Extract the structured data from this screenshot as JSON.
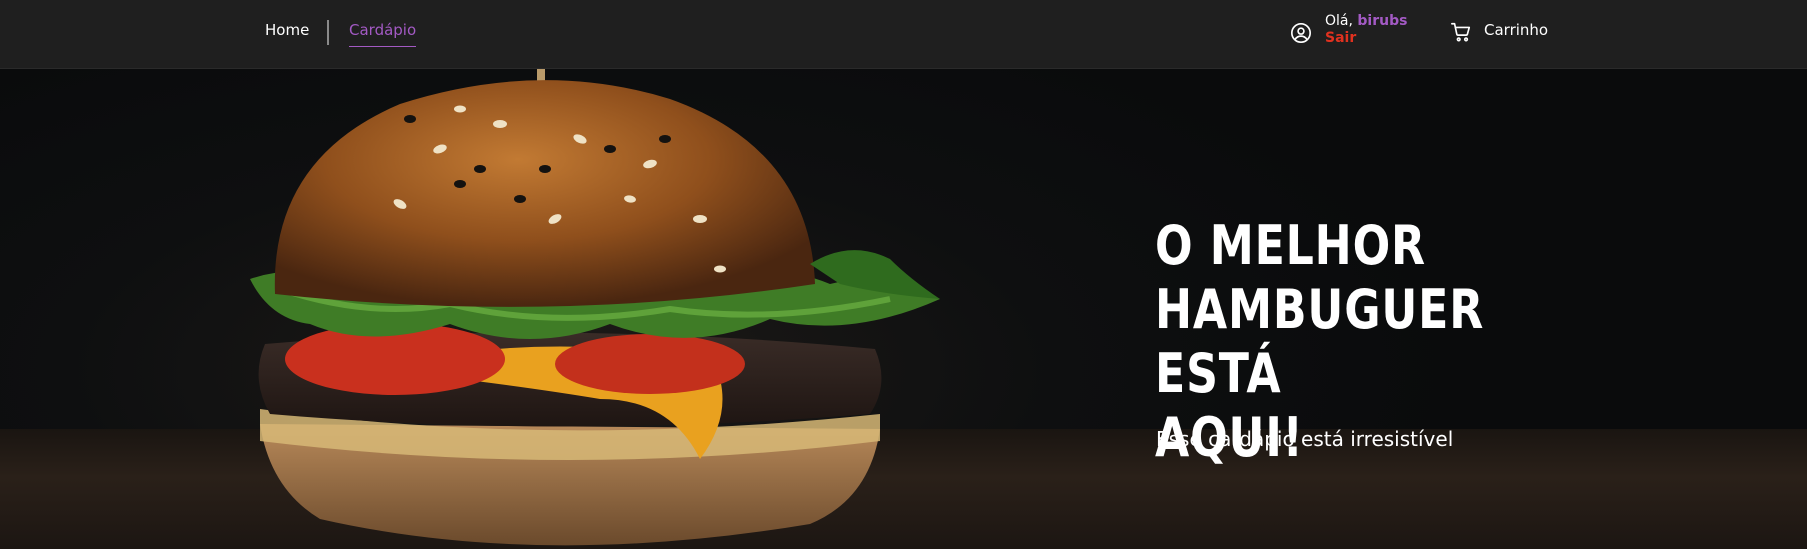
{
  "nav": {
    "home_label": "Home",
    "menu_label": "Cardápio",
    "greeting_prefix": "Olá,",
    "username": "birubs",
    "logout_label": "Sair",
    "cart_label": "Carrinho"
  },
  "hero": {
    "title_line1": "O MELHOR",
    "title_line2": "HAMBUGUER",
    "title_line3": "ESTÁ AQUI!",
    "subtitle": "Esse cardápio está irresistível"
  },
  "colors": {
    "accent": "#a35ac4",
    "logout": "#e0311f",
    "navbar_bg": "#1f1f1f"
  },
  "icons": [
    "user-circle-icon",
    "cart-icon"
  ]
}
